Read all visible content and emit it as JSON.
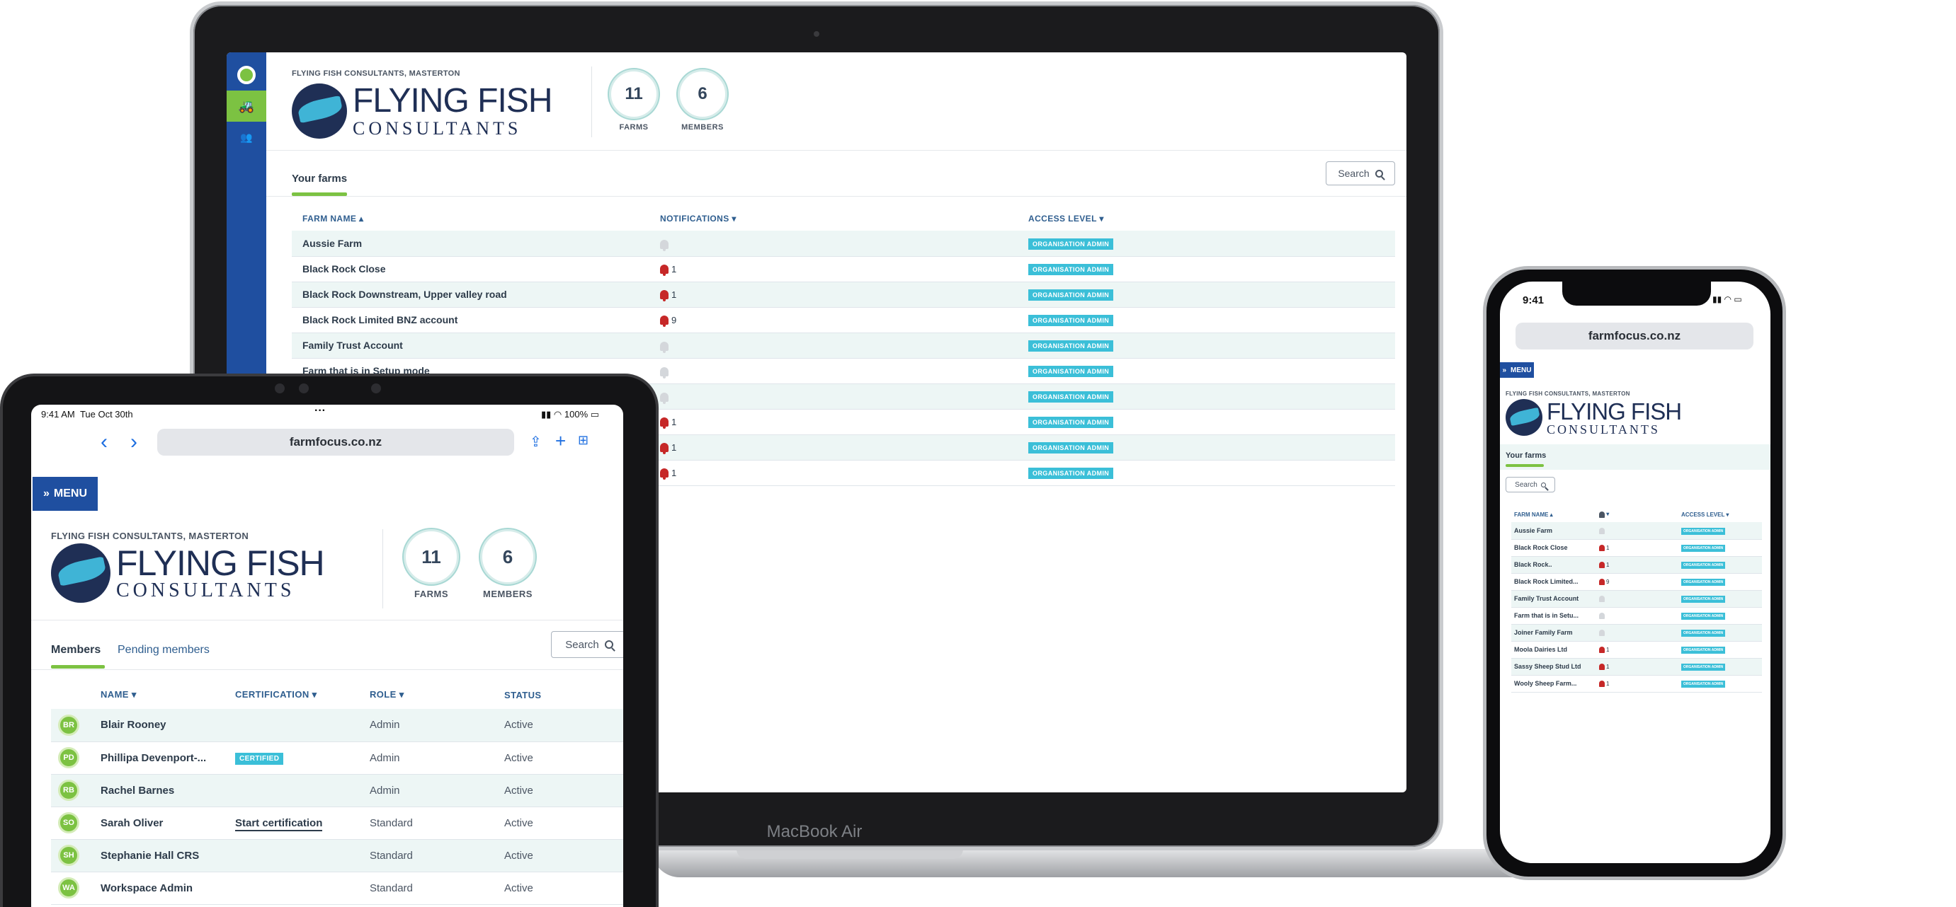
{
  "laptop": {
    "brand": "MacBook Air",
    "org_label": "FLYING FISH CONSULTANTS, MASTERTON",
    "logo_line1": "FLYING FISH",
    "logo_line2": "CONSULTANTS",
    "stats": [
      {
        "value": "11",
        "label": "FARMS"
      },
      {
        "value": "6",
        "label": "MEMBERS"
      }
    ],
    "tab": "Your farms",
    "search_label": "Search",
    "columns": {
      "farm_name": "FARM NAME",
      "notifications": "NOTIFICATIONS",
      "access_level": "ACCESS LEVEL"
    },
    "rows": [
      {
        "name": "Aussie Farm",
        "bell": false,
        "count": "",
        "access": "ORGANISATION ADMIN"
      },
      {
        "name": "Black Rock Close",
        "bell": true,
        "count": "1",
        "access": "ORGANISATION ADMIN"
      },
      {
        "name": "Black Rock Downstream, Upper valley road",
        "bell": true,
        "count": "1",
        "access": "ORGANISATION ADMIN"
      },
      {
        "name": "Black Rock Limited BNZ account",
        "bell": true,
        "count": "9",
        "access": "ORGANISATION ADMIN"
      },
      {
        "name": "Family Trust Account",
        "bell": false,
        "count": "",
        "access": "ORGANISATION ADMIN"
      },
      {
        "name": "Farm that is in Setup mode",
        "bell": false,
        "count": "",
        "access": "ORGANISATION ADMIN"
      },
      {
        "name": "",
        "bell": false,
        "count": "",
        "access": "ORGANISATION ADMIN"
      },
      {
        "name": "",
        "bell": true,
        "count": "1",
        "access": "ORGANISATION ADMIN"
      },
      {
        "name": "",
        "bell": true,
        "count": "1",
        "access": "ORGANISATION ADMIN"
      },
      {
        "name": "",
        "bell": true,
        "count": "1",
        "access": "ORGANISATION ADMIN"
      }
    ]
  },
  "tablet": {
    "time": "9:41 AM",
    "date": "Tue Oct 30th",
    "battery": "100%",
    "url": "farmfocus.co.nz",
    "menu_label": "MENU",
    "org_label": "FLYING FISH CONSULTANTS, MASTERTON",
    "logo_line1": "FLYING FISH",
    "logo_line2": "CONSULTANTS",
    "stats": [
      {
        "value": "11",
        "label": "FARMS"
      },
      {
        "value": "6",
        "label": "MEMBERS"
      }
    ],
    "tabs": [
      "Members",
      "Pending members"
    ],
    "search_label": "Search",
    "columns": {
      "name": "NAME",
      "certification": "CERTIFICATION",
      "role": "ROLE",
      "status": "STATUS"
    },
    "members": [
      {
        "initials": "BR",
        "name": "Blair Rooney",
        "certification": "",
        "cert_type": "none",
        "role": "Admin",
        "status": "Active"
      },
      {
        "initials": "PD",
        "name": "Phillipa Devenport-...",
        "certification": "CERTIFIED",
        "cert_type": "badge",
        "role": "Admin",
        "status": "Active"
      },
      {
        "initials": "RB",
        "name": "Rachel Barnes",
        "certification": "",
        "cert_type": "none",
        "role": "Admin",
        "status": "Active"
      },
      {
        "initials": "SO",
        "name": "Sarah Oliver",
        "certification": "Start certification",
        "cert_type": "link",
        "role": "Standard",
        "status": "Active"
      },
      {
        "initials": "SH",
        "name": "Stephanie Hall CRS",
        "certification": "",
        "cert_type": "none",
        "role": "Standard",
        "status": "Active"
      },
      {
        "initials": "WA",
        "name": "Workspace Admin",
        "certification": "",
        "cert_type": "none",
        "role": "Standard",
        "status": "Active"
      }
    ]
  },
  "phone": {
    "time": "9:41",
    "url": "farmfocus.co.nz",
    "menu_label": "MENU",
    "org_label": "FLYING FISH CONSULTANTS, MASTERTON",
    "logo_line1": "FLYING FISH",
    "logo_line2": "CONSULTANTS",
    "tab": "Your farms",
    "search_label": "Search",
    "columns": {
      "farm_name": "FARM NAME",
      "access_level": "ACCESS LEVEL"
    },
    "rows": [
      {
        "name": "Aussie Farm",
        "bell": false,
        "count": "",
        "access": "ORGANISATION ADMIN"
      },
      {
        "name": "Black Rock Close",
        "bell": true,
        "count": "1",
        "access": "ORGANISATION ADMIN"
      },
      {
        "name": "Black Rock..",
        "bell": true,
        "count": "1",
        "access": "ORGANISATION ADMIN"
      },
      {
        "name": "Black Rock Limited...",
        "bell": true,
        "count": "9",
        "access": "ORGANISATION ADMIN"
      },
      {
        "name": "Family Trust Account",
        "bell": false,
        "count": "",
        "access": "ORGANISATION ADMIN"
      },
      {
        "name": "Farm that is in Setu...",
        "bell": false,
        "count": "",
        "access": "ORGANISATION ADMIN"
      },
      {
        "name": "Joiner Family Farm",
        "bell": false,
        "count": "",
        "access": "ORGANISATION ADMIN"
      },
      {
        "name": "Moola Dairies Ltd",
        "bell": true,
        "count": "1",
        "access": "ORGANISATION ADMIN"
      },
      {
        "name": "Sassy Sheep Stud Ltd",
        "bell": true,
        "count": "1",
        "access": "ORGANISATION ADMIN"
      },
      {
        "name": "Wooly Sheep Farm...",
        "bell": true,
        "count": "1",
        "access": "ORGANISATION ADMIN"
      }
    ]
  },
  "colors": {
    "brand_blue": "#1f4fa0",
    "accent_green": "#7cc242",
    "badge_cyan": "#3bbfd8",
    "bell_red": "#c62828",
    "row_tint": "#edf6f5"
  }
}
